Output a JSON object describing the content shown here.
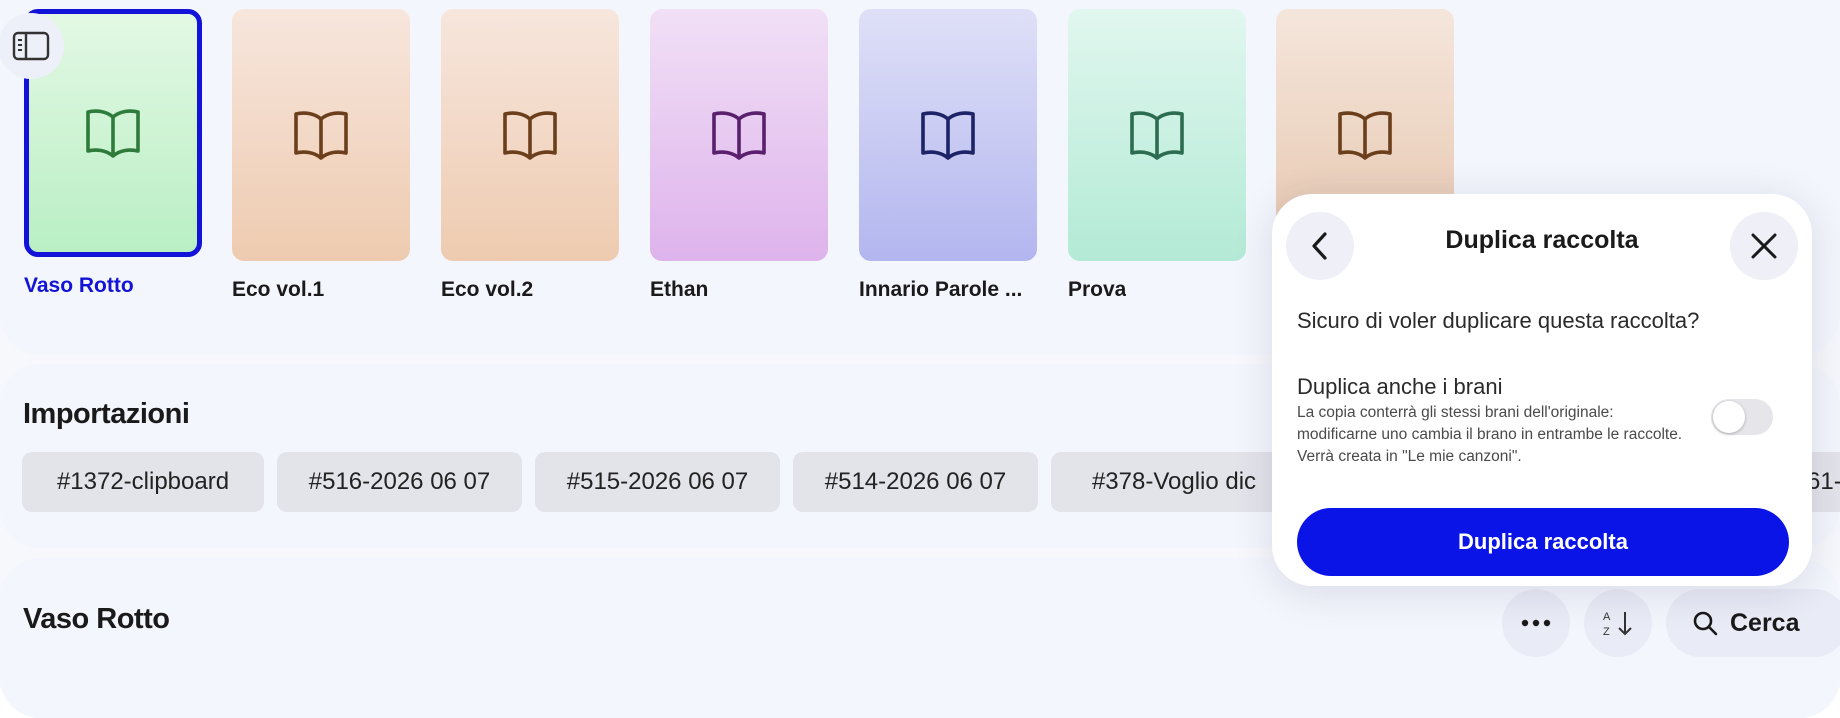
{
  "colors": {
    "accent": "#1212d8",
    "primary_button": "#0a14e6",
    "chip_bg": "#e3e3ea",
    "page_bg": "#f4f6fd"
  },
  "icons": {
    "sidebar_toggle": "sidebar-panel-icon",
    "cover": "open-book-icon",
    "back": "chevron-left-icon",
    "close": "close-icon",
    "more": "more-dots-icon",
    "sort": "sort-az-icon",
    "search": "search-icon"
  },
  "collections": [
    {
      "label": "Vaso Rotto",
      "selected": true,
      "gradient": [
        "#e3f8e4",
        "#b9efc4"
      ],
      "icon_color": "#2f7b3c"
    },
    {
      "label": "Eco vol.1",
      "selected": false,
      "gradient": [
        "#f7e6dd",
        "#eecbb0"
      ],
      "icon_color": "#6b3f1c"
    },
    {
      "label": "Eco vol.2",
      "selected": false,
      "gradient": [
        "#f7e6dd",
        "#eecbb0"
      ],
      "icon_color": "#6b3f1c"
    },
    {
      "label": "Ethan",
      "selected": false,
      "gradient": [
        "#f1e0f6",
        "#deb3ec"
      ],
      "icon_color": "#5a1f6d"
    },
    {
      "label": "Innario Parole ...",
      "selected": false,
      "gradient": [
        "#dfe0f7",
        "#b3b6ef"
      ],
      "icon_color": "#1c2366"
    },
    {
      "label": "Prova",
      "selected": false,
      "gradient": [
        "#e1f7ef",
        "#b3ead6"
      ],
      "icon_color": "#2c6c50"
    },
    {
      "label": "",
      "selected": false,
      "gradient": [
        "#f5e6dc",
        "#e6c6ae"
      ],
      "icon_color": "#6b3f1c"
    }
  ],
  "imports": {
    "title": "Importazioni",
    "chips": [
      "#1372-clipboard",
      "#516-2026 06 07",
      "#515-2026 06 07",
      "#514-2026 06 07",
      "#378-Voglio dic",
      "61-"
    ]
  },
  "collection_section": {
    "title": "Vaso Rotto",
    "search_label": "Cerca"
  },
  "modal": {
    "title": "Duplica raccolta",
    "question": "Sicuro di voler duplicare questa raccolta?",
    "option_title": "Duplica anche i brani",
    "option_description": "La copia conterrà gli stessi brani dell'originale: modificarne uno cambia il brano in entrambe le raccolte. Verrà creata in \"Le mie canzoni\".",
    "toggle_on": false,
    "confirm_label": "Duplica raccolta"
  }
}
